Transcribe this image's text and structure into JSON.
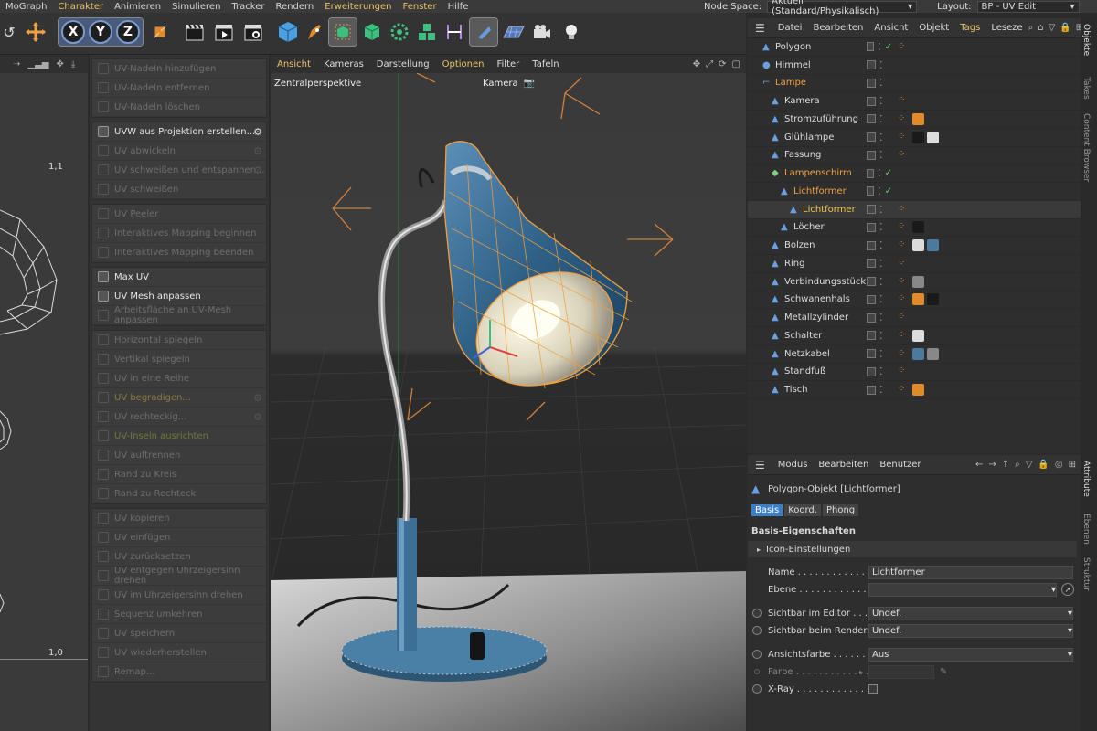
{
  "menubar": {
    "items": [
      "MoGraph",
      "Charakter",
      "Animieren",
      "Simulieren",
      "Tracker",
      "Rendern",
      "Erweiterungen",
      "Fenster",
      "Hilfe"
    ],
    "highlighted": [
      "Charakter",
      "Erweiterungen",
      "Fenster"
    ],
    "node_space_label": "Node Space:",
    "node_space_value": "Aktuell (Standard/Physikalisch)",
    "layout_label": "Layout:",
    "layout_value": "BP - UV Edit"
  },
  "toolbar": {
    "axis_x": "X",
    "axis_y": "Y",
    "axis_z": "Z"
  },
  "uv_canvas": {
    "coord_top": "1,1",
    "coord_bottom": "1,0"
  },
  "uv_tools": {
    "groups": [
      [
        {
          "label": "UV-Nadeln hinzufügen",
          "on": false
        },
        {
          "label": "UV-Nadeln entfernen",
          "on": false
        },
        {
          "label": "UV-Nadeln löschen",
          "on": false
        }
      ],
      [
        {
          "label": "UVW aus Projektion erstellen...",
          "on": true,
          "gear": true
        },
        {
          "label": "UV abwickeln",
          "on": false,
          "gear": true
        },
        {
          "label": "UV schweißen und entspannen...",
          "on": false,
          "gear": true
        },
        {
          "label": "UV schweißen",
          "on": false
        }
      ],
      [
        {
          "label": "UV Peeler",
          "on": false
        },
        {
          "label": "Interaktives Mapping beginnen",
          "on": false
        },
        {
          "label": "Interaktives Mapping beenden",
          "on": false
        }
      ],
      [
        {
          "label": "Max UV",
          "on": true
        },
        {
          "label": "UV Mesh anpassen",
          "on": true
        },
        {
          "label": "Arbeitsfläche an UV-Mesh anpassen",
          "on": false
        }
      ],
      [
        {
          "label": "Horizontal spiegeln",
          "on": false
        },
        {
          "label": "Vertikal spiegeln",
          "on": false
        },
        {
          "label": "UV in eine Reihe",
          "on": false
        },
        {
          "label": "UV begradigen...",
          "on": false,
          "gear": true,
          "tint": "#8a7a3a"
        },
        {
          "label": "UV rechteckig...",
          "on": false,
          "gear": true
        },
        {
          "label": "UV-Inseln ausrichten",
          "on": false,
          "tint": "#6e7a3a"
        },
        {
          "label": "UV auftrennen",
          "on": false
        },
        {
          "label": "Rand zu Kreis",
          "on": false
        },
        {
          "label": "Rand zu Rechteck",
          "on": false
        }
      ],
      [
        {
          "label": "UV kopieren",
          "on": false
        },
        {
          "label": "UV einfügen",
          "on": false
        },
        {
          "label": "UV zurücksetzen",
          "on": false
        },
        {
          "label": "UV entgegen Uhrzeigersinn drehen",
          "on": false
        },
        {
          "label": "UV im Uhrzeigersinn drehen",
          "on": false
        },
        {
          "label": "Sequenz umkehren",
          "on": false
        },
        {
          "label": "UV speichern",
          "on": false
        },
        {
          "label": "UV wiederherstellen",
          "on": false
        },
        {
          "label": "Remap...",
          "on": false
        }
      ]
    ]
  },
  "viewport": {
    "menu": [
      "Ansicht",
      "Kameras",
      "Darstellung",
      "Optionen",
      "Filter",
      "Tafeln"
    ],
    "highlighted": [
      "Ansicht",
      "Optionen"
    ],
    "perspective": "Zentralperspektive",
    "camera": "Kamera"
  },
  "object_manager": {
    "menu": [
      "Datei",
      "Bearbeiten",
      "Ansicht",
      "Objekt",
      "Tags",
      "Leseze"
    ],
    "highlighted": [
      "Tags"
    ],
    "rows": [
      {
        "name": "Polygon",
        "indent": 0,
        "color": "normal"
      },
      {
        "name": "Himmel",
        "indent": 0,
        "color": "normal"
      },
      {
        "name": "Lampe",
        "indent": 0,
        "color": "orange"
      },
      {
        "name": "Kamera",
        "indent": 1,
        "color": "normal"
      },
      {
        "name": "Stromzuführung",
        "indent": 1,
        "color": "normal"
      },
      {
        "name": "Glühlampe",
        "indent": 1,
        "color": "normal"
      },
      {
        "name": "Fassung",
        "indent": 1,
        "color": "normal"
      },
      {
        "name": "Lampenschirm",
        "indent": 1,
        "color": "orange"
      },
      {
        "name": "Lichtformer",
        "indent": 2,
        "color": "orange"
      },
      {
        "name": "Lichtformer",
        "indent": 3,
        "color": "yellow"
      },
      {
        "name": "Löcher",
        "indent": 2,
        "color": "normal"
      },
      {
        "name": "Bolzen",
        "indent": 1,
        "color": "normal"
      },
      {
        "name": "Ring",
        "indent": 1,
        "color": "normal"
      },
      {
        "name": "Verbindungsstück",
        "indent": 1,
        "color": "normal"
      },
      {
        "name": "Schwanenhals",
        "indent": 1,
        "color": "normal"
      },
      {
        "name": "Metallzylinder",
        "indent": 1,
        "color": "normal"
      },
      {
        "name": "Schalter",
        "indent": 1,
        "color": "normal"
      },
      {
        "name": "Netzkabel",
        "indent": 1,
        "color": "normal"
      },
      {
        "name": "Standfuß",
        "indent": 1,
        "color": "normal"
      },
      {
        "name": "Tisch",
        "indent": 1,
        "color": "normal"
      }
    ]
  },
  "side_tabs_top": [
    "Objekte",
    "Takes",
    "Content Browser"
  ],
  "side_tabs_bottom": [
    "Attribute",
    "Ebenen",
    "Struktur"
  ],
  "attribute_manager": {
    "menu": [
      "Modus",
      "Bearbeiten",
      "Benutzer"
    ],
    "object_title": "Polygon-Objekt [Lichtformer]",
    "tabs": [
      "Basis",
      "Koord.",
      "Phong"
    ],
    "active_tab": "Basis",
    "section": "Basis-Eigenschaften",
    "subsection": "Icon-Einstellungen",
    "fields": {
      "name_label": "Name . . . . . . . . . . . . . .",
      "name_value": "Lichtformer",
      "layer_label": "Ebene . . . . . . . . . . . . . .",
      "layer_value": "",
      "editor_label": "Sichtbar im Editor . . . .",
      "editor_value": "Undef.",
      "render_label": "Sichtbar beim Rendern",
      "render_value": "Undef.",
      "viewcolor_label": "Ansichtsfarbe . . . . . . .",
      "viewcolor_value": "Aus",
      "color_label": "Farbe . . . . . . . . . . . . . .",
      "xray_label": "X-Ray . . . . . . . . . . . . . ."
    }
  },
  "colors": {
    "accent_orange": "#f0a040",
    "accent_yellow": "#e9c46a",
    "active_blue": "#3d7fc4"
  }
}
